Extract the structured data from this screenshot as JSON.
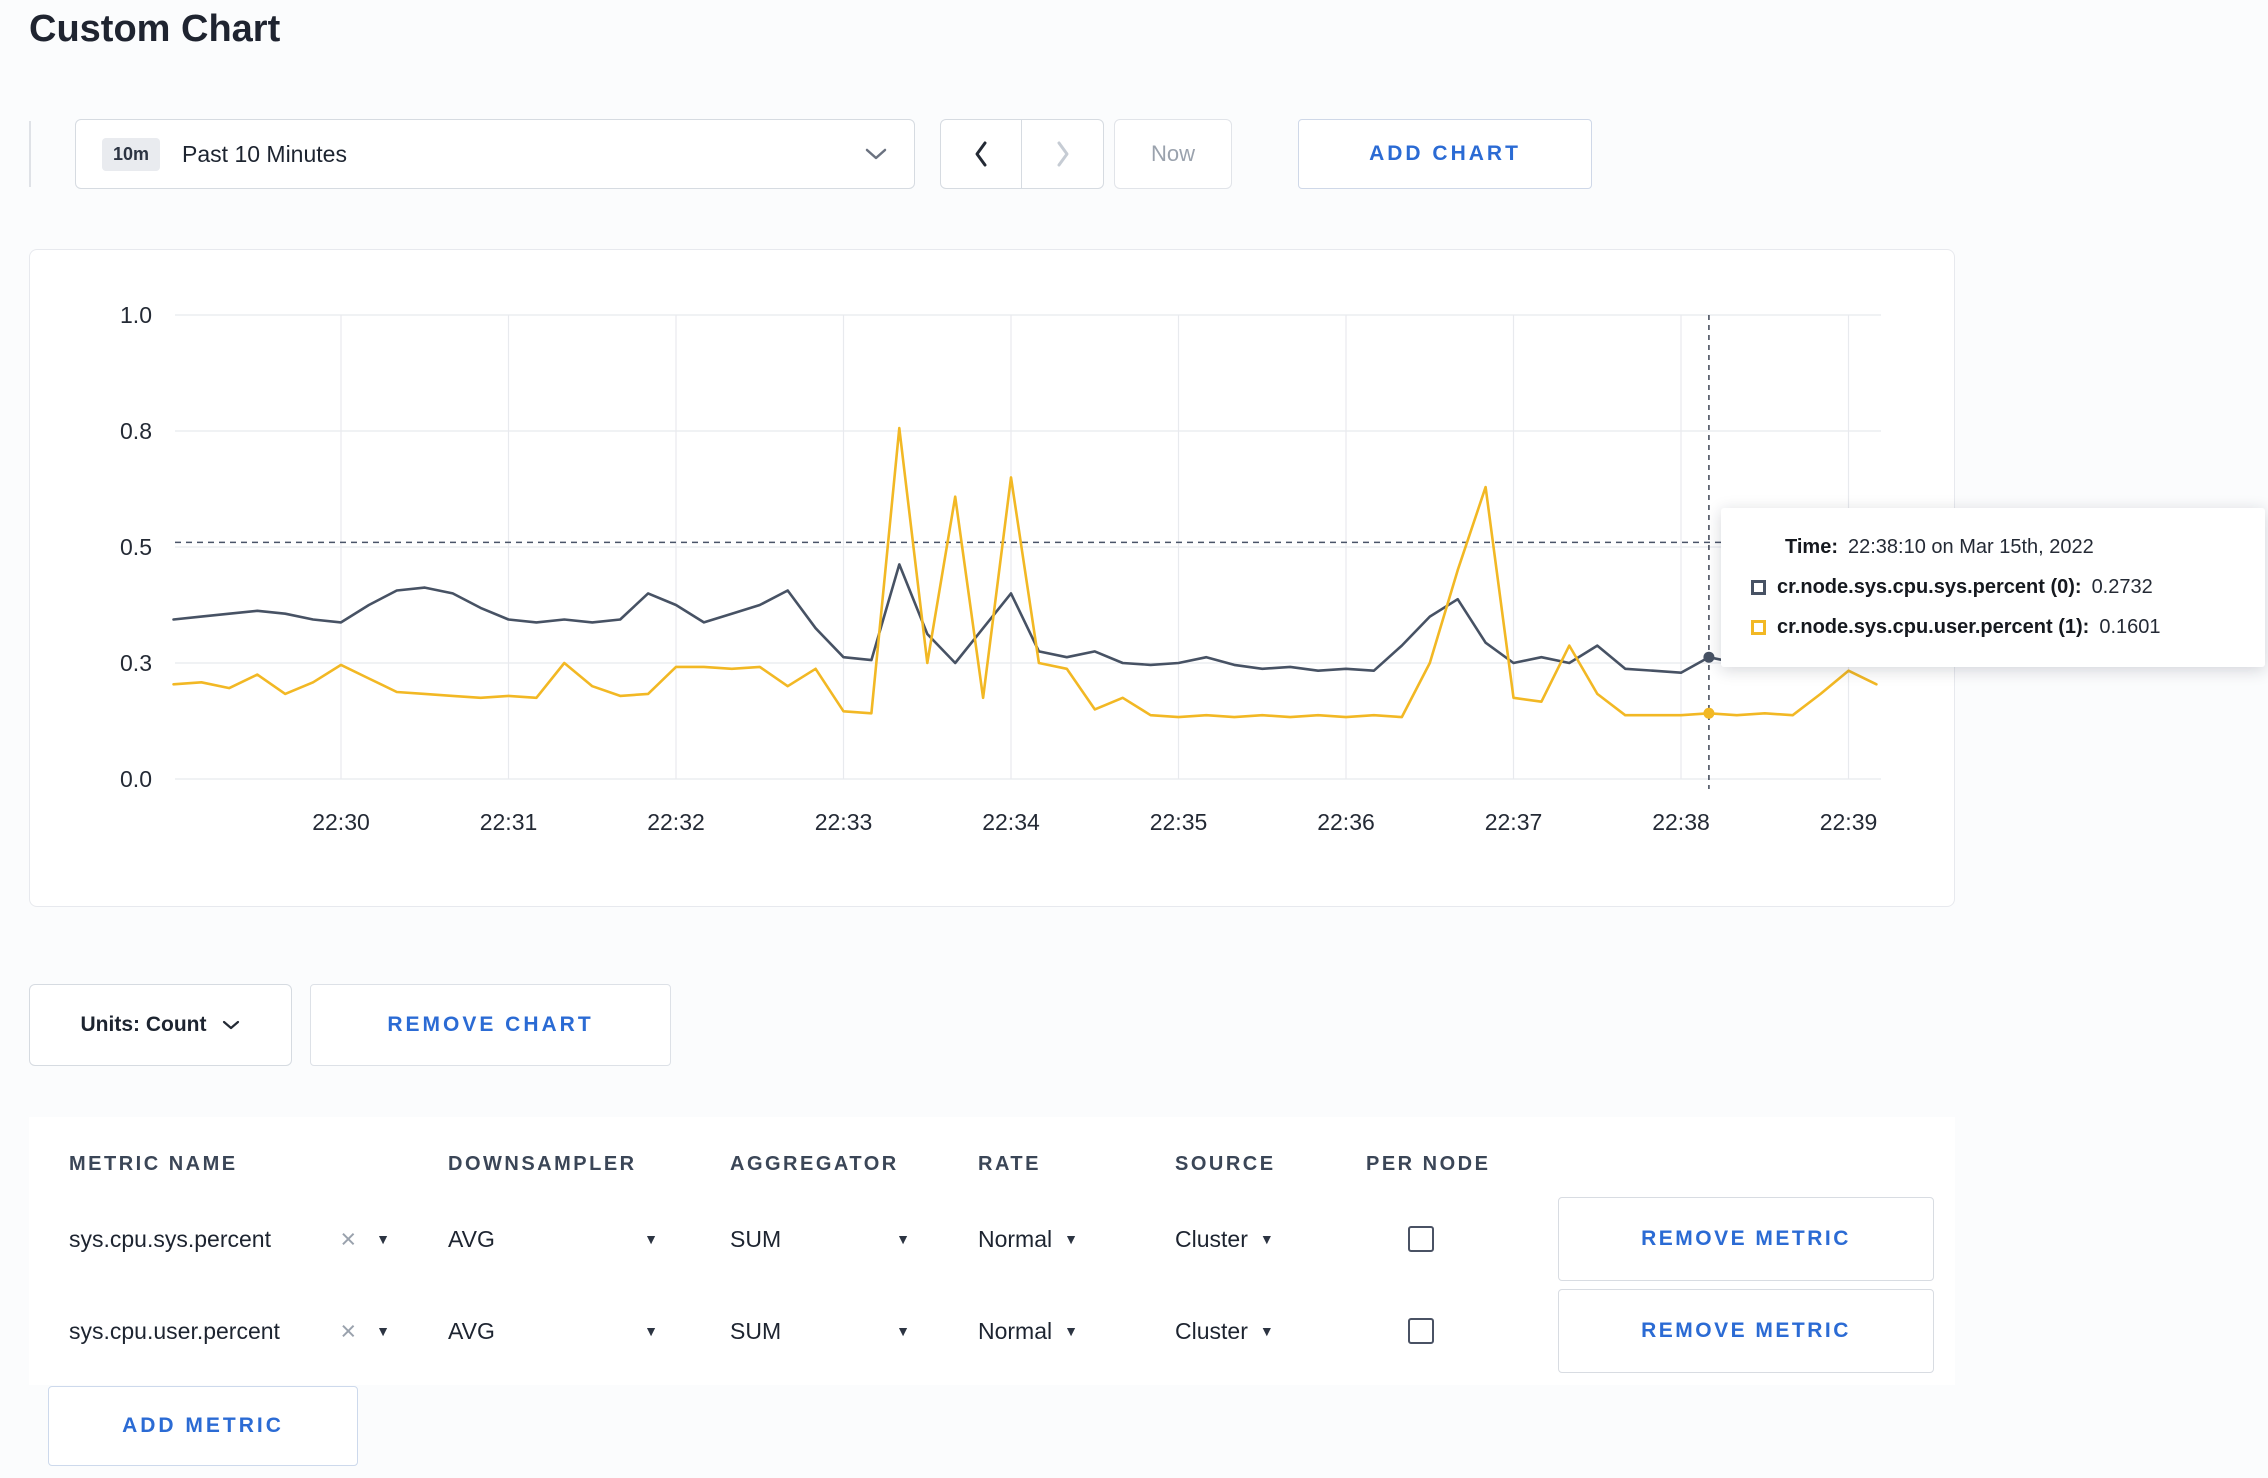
{
  "page": {
    "title": "Custom Chart"
  },
  "toolbar": {
    "time_range_badge": "10m",
    "time_range_label": "Past 10 Minutes",
    "now_label": "Now",
    "add_chart_label": "ADD CHART"
  },
  "icons": {
    "remove_tag": "×",
    "dropdown_arrow": "▼"
  },
  "colors": {
    "accent_blue": "#2b6bd4"
  },
  "chart_data": {
    "type": "line",
    "title": "",
    "xlabel": "",
    "ylabel": "",
    "ylim": [
      0,
      1
    ],
    "grid": true,
    "x_tick_labels": [
      "22:30",
      "22:31",
      "22:32",
      "22:33",
      "22:34",
      "22:35",
      "22:36",
      "22:37",
      "22:38",
      "22:39"
    ],
    "y_tick_labels": [
      "0.0",
      "0.3",
      "0.5",
      "0.8",
      "1.0"
    ],
    "y_tick_values": [
      0.0,
      0.3,
      0.5,
      0.8,
      1.0
    ],
    "x_start_min": -1.0,
    "point_interval_min": 0.1666667,
    "threshold_line": 0.512,
    "crosshair": {
      "time_min": 8.1667,
      "values": [
        0.31,
        0.17
      ]
    },
    "series": [
      {
        "name": "cr.node.sys.cpu.sys.percent",
        "color": "#475264",
        "values": [
          0.375,
          0.38,
          0.385,
          0.39,
          0.385,
          0.375,
          0.37,
          0.4,
          0.425,
          0.43,
          0.42,
          0.395,
          0.375,
          0.37,
          0.375,
          0.37,
          0.375,
          0.42,
          0.4,
          0.37,
          0.385,
          0.4,
          0.425,
          0.36,
          0.31,
          0.305,
          0.47,
          0.35,
          0.3,
          0.36,
          0.42,
          0.32,
          0.31,
          0.32,
          0.3,
          0.295,
          0.3,
          0.31,
          0.295,
          0.285,
          0.29,
          0.28,
          0.285,
          0.28,
          0.33,
          0.38,
          0.41,
          0.335,
          0.3,
          0.31,
          0.3,
          0.33,
          0.285,
          0.28,
          0.275,
          0.31,
          0.3,
          0.295,
          0.3,
          0.305,
          0.3,
          0.305
        ]
      },
      {
        "name": "cr.node.sys.cpu.user.percent",
        "color": "#f2b824",
        "values": [
          0.245,
          0.25,
          0.235,
          0.27,
          0.22,
          0.25,
          0.295,
          0.26,
          0.225,
          0.22,
          0.215,
          0.21,
          0.215,
          0.21,
          0.3,
          0.24,
          0.215,
          0.22,
          0.29,
          0.29,
          0.285,
          0.29,
          0.24,
          0.285,
          0.175,
          0.17,
          0.805,
          0.3,
          0.63,
          0.21,
          0.68,
          0.3,
          0.285,
          0.18,
          0.21,
          0.165,
          0.16,
          0.165,
          0.16,
          0.165,
          0.16,
          0.165,
          0.16,
          0.165,
          0.16,
          0.3,
          0.46,
          0.655,
          0.21,
          0.2,
          0.33,
          0.22,
          0.165,
          0.165,
          0.165,
          0.17,
          0.165,
          0.17,
          0.165,
          0.22,
          0.28,
          0.245
        ]
      }
    ]
  },
  "tooltip": {
    "time_label": "Time:",
    "time_value": "22:38:10 on Mar 15th, 2022",
    "series": [
      {
        "label": "cr.node.sys.cpu.sys.percent (0):",
        "value": "0.2732"
      },
      {
        "label": "cr.node.sys.cpu.user.percent (1):",
        "value": "0.1601"
      }
    ]
  },
  "controls": {
    "units_label": "Units: Count",
    "remove_chart_label": "REMOVE CHART",
    "add_metric_label": "ADD METRIC"
  },
  "table": {
    "headers": [
      "METRIC NAME",
      "DOWNSAMPLER",
      "AGGREGATOR",
      "RATE",
      "SOURCE",
      "PER NODE"
    ],
    "rows": [
      {
        "metric": "sys.cpu.sys.percent",
        "downsampler": "AVG",
        "aggregator": "SUM",
        "rate": "Normal",
        "source": "Cluster",
        "per_node_checked": false,
        "remove_label": "REMOVE METRIC"
      },
      {
        "metric": "sys.cpu.user.percent",
        "downsampler": "AVG",
        "aggregator": "SUM",
        "rate": "Normal",
        "source": "Cluster",
        "per_node_checked": false,
        "remove_label": "REMOVE METRIC"
      }
    ]
  }
}
